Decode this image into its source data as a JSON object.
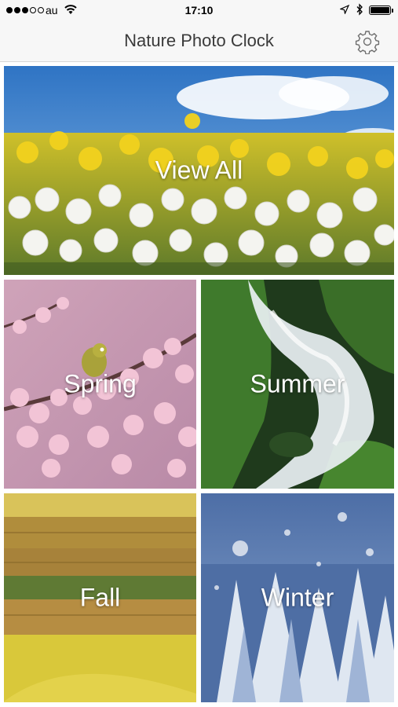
{
  "status_bar": {
    "carrier": "au",
    "time": "17:10",
    "signal_bars_filled": 3,
    "signal_bars_total": 5,
    "battery_level": 1.0,
    "icons": [
      "wifi-icon",
      "location-arrow-icon",
      "bluetooth-icon",
      "battery-icon"
    ]
  },
  "nav": {
    "title": "Nature Photo Clock",
    "settings_icon": "gear-icon"
  },
  "tiles": [
    {
      "label": "View All"
    },
    {
      "label": "Spring"
    },
    {
      "label": "Summer"
    },
    {
      "label": "Fall"
    },
    {
      "label": "Winter"
    }
  ],
  "colors": {
    "bar_background": "#f7f7f7",
    "title_text": "#3a3a3a",
    "tile_label": "#ffffff"
  }
}
